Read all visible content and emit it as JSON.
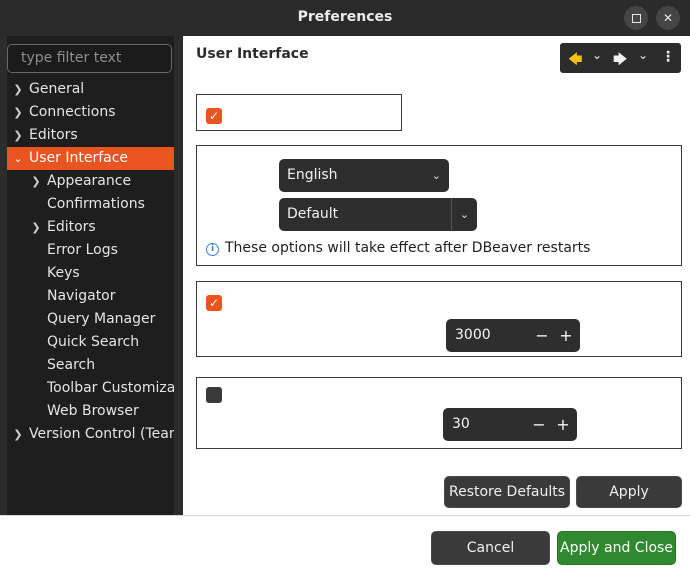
{
  "window": {
    "title": "Preferences",
    "maximize_icon": "maximize-icon",
    "close_glyph": "✕"
  },
  "sidebar": {
    "filter_placeholder": "type filter text",
    "items": [
      {
        "label": "General",
        "expandable": true,
        "level": 0
      },
      {
        "label": "Connections",
        "expandable": true,
        "level": 0
      },
      {
        "label": "Editors",
        "expandable": true,
        "level": 0
      },
      {
        "label": "User Interface",
        "expandable": true,
        "expanded": true,
        "selected": true,
        "level": 0
      },
      {
        "label": "Appearance",
        "expandable": true,
        "level": 1
      },
      {
        "label": "Confirmations",
        "expandable": false,
        "level": 1
      },
      {
        "label": "Editors",
        "expandable": true,
        "level": 1
      },
      {
        "label": "Error Logs",
        "expandable": false,
        "level": 1
      },
      {
        "label": "Keys",
        "expandable": false,
        "level": 1
      },
      {
        "label": "Navigator",
        "expandable": false,
        "level": 1
      },
      {
        "label": "Query Manager",
        "expandable": false,
        "level": 1
      },
      {
        "label": "Quick Search",
        "expandable": false,
        "level": 1
      },
      {
        "label": "Search",
        "expandable": false,
        "level": 1
      },
      {
        "label": "Toolbar Customiza",
        "expandable": false,
        "level": 1
      },
      {
        "label": "Web Browser",
        "expandable": false,
        "level": 1
      },
      {
        "label": "Version Control (Team",
        "expandable": true,
        "level": 0
      }
    ]
  },
  "main": {
    "page_title": "User Interface",
    "nav": {
      "back_glyph": "🡄",
      "forward_glyph": "🡆",
      "dropdown_glyph": "⌄",
      "menu_glyph": "⋮"
    },
    "language_combo": "English",
    "theme_combo": "Default",
    "restart_notice": "These options will take effect after DBeaver restarts",
    "info_glyph": "i",
    "notifications_checked": true,
    "notifications_timeout": "3000",
    "long_operations_checked": false,
    "long_operations_timeout": "30",
    "general_checked": true,
    "spin_minus": "−",
    "spin_plus": "+",
    "check_glyph": "✓"
  },
  "buttons": {
    "restore_defaults": "Restore Defaults",
    "apply": "Apply",
    "cancel": "Cancel",
    "apply_and_close": "Apply and Close"
  },
  "colors": {
    "accent": "#e95420",
    "primary_button": "#2f8a2f",
    "info": "#3584e4"
  }
}
